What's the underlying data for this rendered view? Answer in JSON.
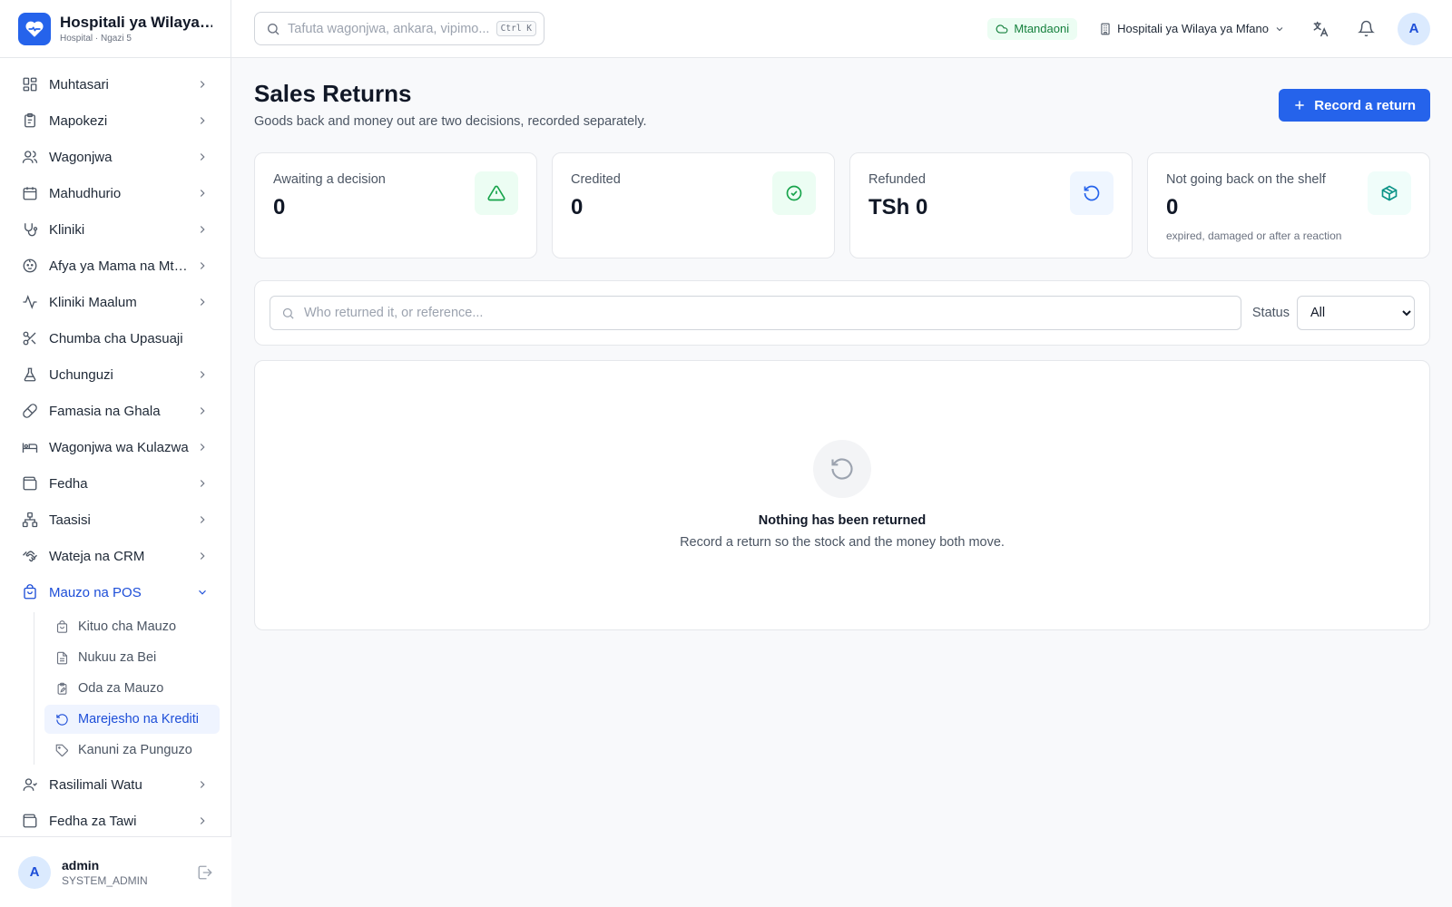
{
  "brand": {
    "name": "Hospitali ya Wilaya ya Mfano",
    "sub": "Hospital · Ngazi 5"
  },
  "sidebar": {
    "items": [
      {
        "label": "Muhtasari",
        "icon": "dashboard-icon"
      },
      {
        "label": "Mapokezi",
        "icon": "clipboard-icon"
      },
      {
        "label": "Wagonjwa",
        "icon": "users-icon"
      },
      {
        "label": "Mahudhurio",
        "icon": "calendar-icon"
      },
      {
        "label": "Kliniki",
        "icon": "stethoscope-icon"
      },
      {
        "label": "Afya ya Mama na Mtoto",
        "icon": "baby-icon"
      },
      {
        "label": "Kliniki Maalum",
        "icon": "activity-icon"
      },
      {
        "label": "Chumba cha Upasuaji",
        "icon": "scissors-icon"
      },
      {
        "label": "Uchunguzi",
        "icon": "flask-icon"
      },
      {
        "label": "Famasia na Ghala",
        "icon": "pill-icon"
      },
      {
        "label": "Wagonjwa wa Kulazwa",
        "icon": "bed-icon"
      },
      {
        "label": "Fedha",
        "icon": "wallet-icon"
      },
      {
        "label": "Taasisi",
        "icon": "network-icon"
      },
      {
        "label": "Wateja na CRM",
        "icon": "handshake-icon"
      },
      {
        "label": "Mauzo na POS",
        "icon": "shopping-bag-icon"
      }
    ],
    "sub_items": [
      {
        "label": "Kituo cha Mauzo",
        "icon": "shopping-bag-icon"
      },
      {
        "label": "Nukuu za Bei",
        "icon": "file-text-icon"
      },
      {
        "label": "Oda za Mauzo",
        "icon": "clipboard-edit-icon"
      },
      {
        "label": "Marejesho na Krediti",
        "icon": "rotate-ccw-icon"
      },
      {
        "label": "Kanuni za Punguzo",
        "icon": "tag-icon"
      }
    ],
    "bottom_items": [
      {
        "label": "Rasilimali Watu",
        "icon": "user-round-icon"
      },
      {
        "label": "Fedha za Tawi",
        "icon": "wallet-icon"
      }
    ]
  },
  "user": {
    "initial": "A",
    "name": "admin",
    "role": "SYSTEM_ADMIN"
  },
  "topbar": {
    "search_placeholder": "Tafuta wagonjwa, ankara, vipimo...",
    "shortcut": "Ctrl K",
    "status": "Mtandaoni",
    "facility": "Hospitali ya Wilaya ya Mfano",
    "avatar": "A"
  },
  "page": {
    "title": "Sales Returns",
    "subtitle": "Goods back and money out are two decisions, recorded separately.",
    "primary_button": "Record a return"
  },
  "stats": [
    {
      "label": "Awaiting a decision",
      "value": "0",
      "note": "",
      "icon": "alert-triangle-icon",
      "color": "#16a34a",
      "bg": "#ecfdf3"
    },
    {
      "label": "Credited",
      "value": "0",
      "note": "",
      "icon": "check-circle-icon",
      "color": "#16a34a",
      "bg": "#ecfdf3"
    },
    {
      "label": "Refunded",
      "value": "TSh 0",
      "note": "",
      "icon": "rotate-ccw-icon",
      "color": "#2563eb",
      "bg": "#eff6ff"
    },
    {
      "label": "Not going back on the shelf",
      "value": "0",
      "note": "expired, damaged or after a reaction",
      "icon": "package-icon",
      "color": "#0d9488",
      "bg": "#f0fdfa"
    }
  ],
  "filters": {
    "search_placeholder": "Who returned it, or reference...",
    "status_label": "Status",
    "status_selected": "All"
  },
  "empty": {
    "title": "Nothing has been returned",
    "description": "Record a return so the stock and the money both move."
  },
  "colors": {
    "accent": "#2563eb",
    "online": "#15803d"
  }
}
